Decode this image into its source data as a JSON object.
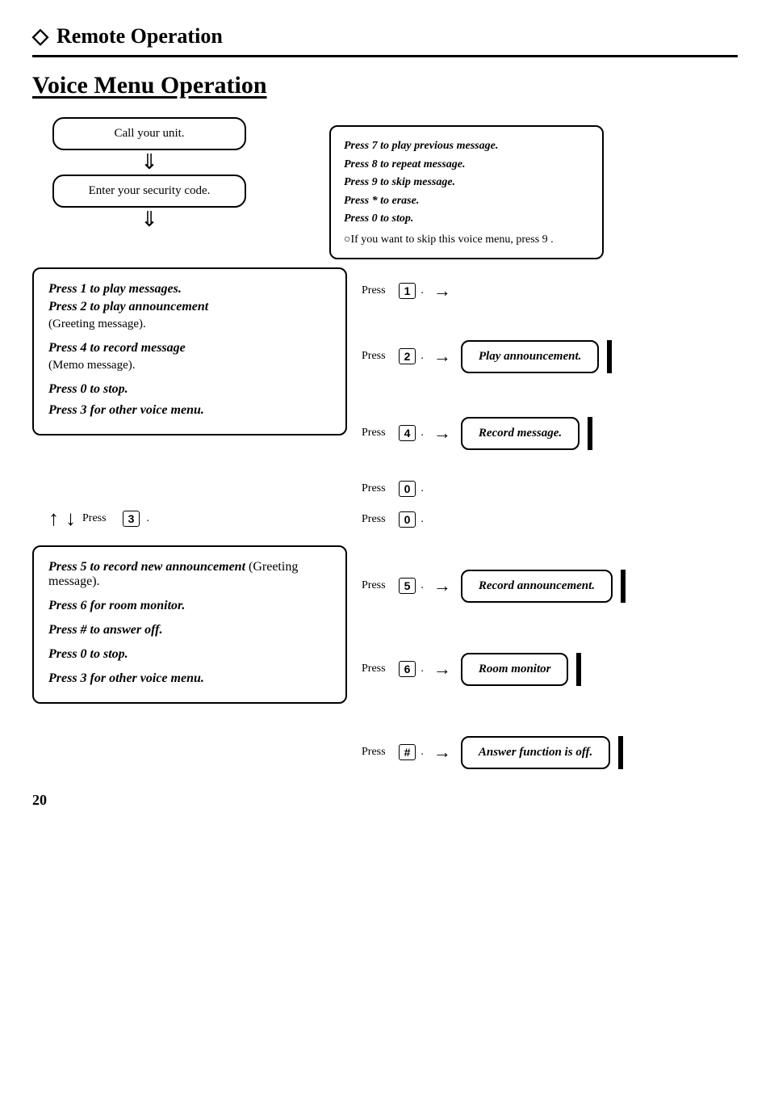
{
  "header": {
    "icon": "◇",
    "title": "Remote Operation"
  },
  "section_title": "Voice Menu Operation",
  "top_flow": {
    "box1": "Call your unit.",
    "box2": "Enter your security code."
  },
  "info_box": {
    "lines": [
      "Press 7 to play previous message.",
      "Press 8 to repeat message.",
      "Press 9 to skip message.",
      "Press * to erase.",
      "Press 0 to stop."
    ],
    "note": "○If you want to skip this voice menu, press 9 ."
  },
  "menu1": {
    "items": [
      {
        "bold": "Press 1 to play messages."
      },
      {
        "bold": "Press 2 to play announcement",
        "normal": "(Greeting message)."
      },
      {
        "bold": "Press 4 to record message",
        "normal": "(Memo message)."
      },
      {
        "bold": "Press 0 to stop."
      },
      {
        "bold": "Press 3 for other voice menu."
      }
    ]
  },
  "press_rows1": [
    {
      "label": "Press",
      "key": "1",
      "arrow": "→"
    },
    {
      "label": "Press",
      "key": "2",
      "arrow": "→",
      "result": "Play announcement."
    },
    {
      "label": "Press",
      "key": "4",
      "arrow": "→",
      "result": "Record message."
    },
    {
      "label": "Press",
      "key": "0",
      "arrow": ""
    }
  ],
  "section2_transition": {
    "press_3_label": "Press",
    "press_3_key": "3",
    "press_0_label": "Press",
    "press_0_key": "0"
  },
  "menu2": {
    "items": [
      {
        "bold": "Press 5 to record new announcement",
        "normal": " (Greeting message)."
      },
      {
        "bold": "Press 6 for room monitor."
      },
      {
        "bold": "Press # to answer off."
      },
      {
        "bold": "Press 0 to stop."
      },
      {
        "bold": "Press 3 for other voice menu."
      }
    ]
  },
  "press_rows2": [
    {
      "label": "Press",
      "key": "5",
      "arrow": "→",
      "result": "Record announcement."
    },
    {
      "label": "Press",
      "key": "6",
      "arrow": "→",
      "result": "Room monitor"
    },
    {
      "label": "Press",
      "key": "#",
      "arrow": "→",
      "result": "Answer function is off."
    }
  ],
  "page_number": "20"
}
